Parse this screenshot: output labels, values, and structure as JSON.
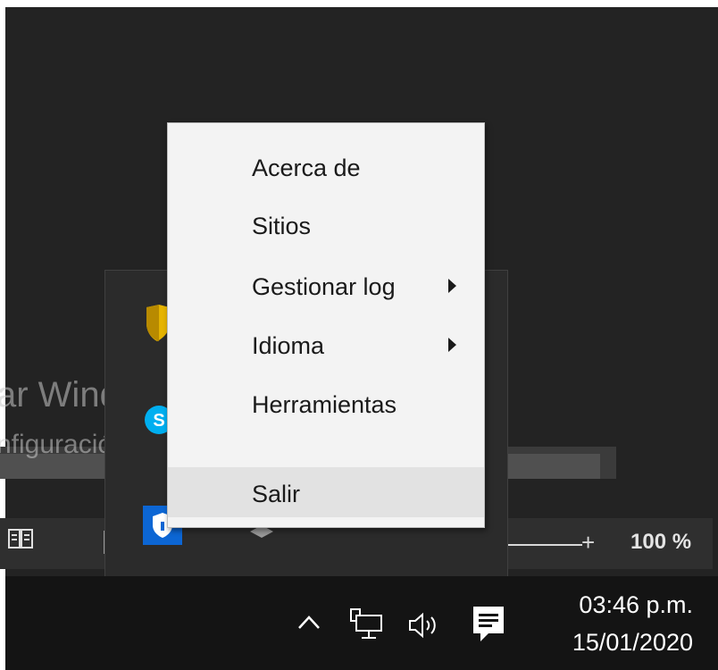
{
  "context_menu": {
    "items": [
      {
        "label": "Acerca de",
        "submenu": false
      },
      {
        "label": "Sitios",
        "submenu": false
      },
      {
        "label": "Gestionar log",
        "submenu": true
      },
      {
        "label": "Idioma",
        "submenu": true
      },
      {
        "label": "Herramientas",
        "submenu": false
      },
      {
        "label": "Salir",
        "submenu": false,
        "highlighted": true
      }
    ]
  },
  "watermark": {
    "title": "ar Windows",
    "subtitle": "nfiguración para activar Windows."
  },
  "status_bar": {
    "zoom_plus": "+",
    "zoom_level": "100 %"
  },
  "taskbar": {
    "clock_time": "03:46 p.m.",
    "clock_date": "15/01/2020",
    "tray_icons": [
      "chevron-up-icon",
      "network-icon",
      "volume-icon",
      "notification-icon"
    ]
  },
  "tray_flyout": {
    "apps": [
      "shield-yellow-icon",
      "skype-icon",
      "defender-shield-icon",
      "small-app-icon"
    ]
  },
  "colors": {
    "menu_bg": "#f3f3f3",
    "menu_highlight": "#e2e2e2",
    "desktop_bg": "#232323",
    "taskbar_bg": "#141414",
    "skype_blue": "#00aff0",
    "defender_blue": "#0c66d4",
    "shield_yellow": "#e6b400"
  }
}
